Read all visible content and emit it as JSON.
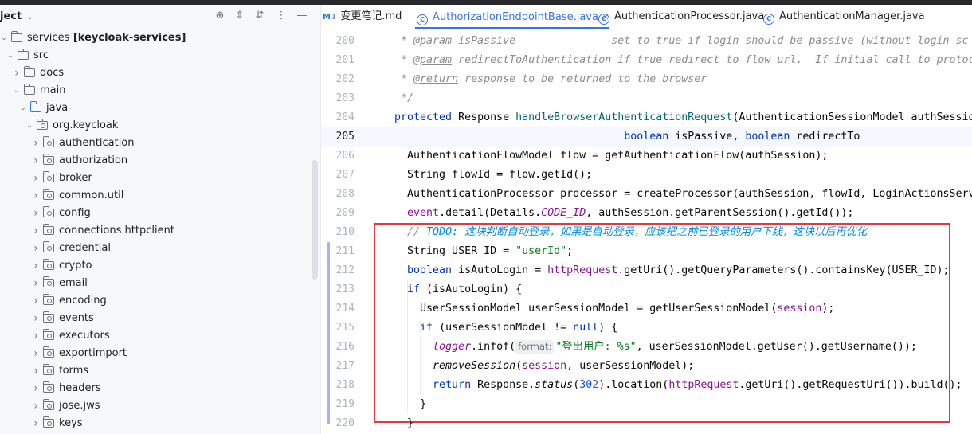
{
  "project": {
    "title": "ject",
    "tree": [
      {
        "label": "services",
        "bold": "[keycloak-services]",
        "depth": 0,
        "arrow": "down",
        "icon": "module"
      },
      {
        "label": "src",
        "depth": 1,
        "arrow": "down",
        "icon": "folder"
      },
      {
        "label": "docs",
        "depth": 2,
        "arrow": "right",
        "icon": "folder"
      },
      {
        "label": "main",
        "depth": 2,
        "arrow": "down",
        "icon": "folder"
      },
      {
        "label": "java",
        "depth": 3,
        "arrow": "down",
        "icon": "source-folder"
      },
      {
        "label": "org.keycloak",
        "depth": 4,
        "arrow": "down",
        "icon": "package"
      },
      {
        "label": "authentication",
        "depth": 5,
        "arrow": "right",
        "icon": "package"
      },
      {
        "label": "authorization",
        "depth": 5,
        "arrow": "right",
        "icon": "package"
      },
      {
        "label": "broker",
        "depth": 5,
        "arrow": "right",
        "icon": "package"
      },
      {
        "label": "common.util",
        "depth": 5,
        "arrow": "right",
        "icon": "package"
      },
      {
        "label": "config",
        "depth": 5,
        "arrow": "right",
        "icon": "package"
      },
      {
        "label": "connections.httpclient",
        "depth": 5,
        "arrow": "right",
        "icon": "package"
      },
      {
        "label": "credential",
        "depth": 5,
        "arrow": "right",
        "icon": "package"
      },
      {
        "label": "crypto",
        "depth": 5,
        "arrow": "right",
        "icon": "package"
      },
      {
        "label": "email",
        "depth": 5,
        "arrow": "right",
        "icon": "package"
      },
      {
        "label": "encoding",
        "depth": 5,
        "arrow": "right",
        "icon": "package"
      },
      {
        "label": "events",
        "depth": 5,
        "arrow": "right",
        "icon": "package"
      },
      {
        "label": "executors",
        "depth": 5,
        "arrow": "right",
        "icon": "package"
      },
      {
        "label": "exportimport",
        "depth": 5,
        "arrow": "right",
        "icon": "package"
      },
      {
        "label": "forms",
        "depth": 5,
        "arrow": "right",
        "icon": "package"
      },
      {
        "label": "headers",
        "depth": 5,
        "arrow": "right",
        "icon": "package"
      },
      {
        "label": "jose.jws",
        "depth": 5,
        "arrow": "right",
        "icon": "package"
      },
      {
        "label": "keys",
        "depth": 5,
        "arrow": "right",
        "icon": "package"
      }
    ]
  },
  "tabs": [
    {
      "label": "变更笔记.md",
      "icon": "markdown-icon",
      "active": false
    },
    {
      "label": "AuthorizationEndpointBase.java",
      "icon": "class-icon",
      "active": true,
      "closable": true
    },
    {
      "label": "AuthenticationProcessor.java",
      "icon": "class-icon",
      "active": false
    },
    {
      "label": "AuthenticationManager.java",
      "icon": "class-icon",
      "active": false
    }
  ],
  "editor": {
    "current_line": 205,
    "lines": [
      {
        "n": 200,
        "tokens": [
          [
            "cm",
            "   * "
          ],
          [
            "tag",
            "@param"
          ],
          [
            "cm",
            " isPassive               set to true if login should be passive (without login sc"
          ]
        ]
      },
      {
        "n": 201,
        "tokens": [
          [
            "cm",
            "   * "
          ],
          [
            "tag",
            "@param"
          ],
          [
            "cm",
            " redirectToAuthentication if true redirect to flow url.  If initial call to protoc"
          ]
        ]
      },
      {
        "n": 202,
        "tokens": [
          [
            "cm",
            "   * "
          ],
          [
            "tag",
            "@return"
          ],
          [
            "cm",
            " response to be returned to the browser"
          ]
        ]
      },
      {
        "n": 203,
        "tokens": [
          [
            "cm",
            "   */"
          ]
        ]
      },
      {
        "n": 204,
        "tokens": [
          [
            "kw",
            "  protected "
          ],
          [
            "",
            "Response "
          ],
          [
            "fn",
            "handleBrowserAuthenticationRequest"
          ],
          [
            "",
            "(AuthenticationSessionModel authSessio"
          ]
        ]
      },
      {
        "n": 205,
        "tokens": [
          [
            "",
            "                                      "
          ],
          [
            "kw",
            "boolean "
          ],
          [
            "",
            "isPassive, "
          ],
          [
            "kw",
            "boolean "
          ],
          [
            "",
            "redirectTo"
          ]
        ]
      },
      {
        "n": 206,
        "tokens": [
          [
            "",
            "    AuthenticationFlowModel flow = getAuthenticationFlow(authSession);"
          ]
        ]
      },
      {
        "n": 207,
        "tokens": [
          [
            "",
            "    String flowId = flow.getId();"
          ]
        ]
      },
      {
        "n": 208,
        "tokens": [
          [
            "",
            "    AuthenticationProcessor processor = createProcessor(authSession, flowId, LoginActionsServ"
          ]
        ]
      },
      {
        "n": 209,
        "tokens": [
          [
            "fld",
            "    event"
          ],
          [
            "",
            ".detail(Details."
          ],
          [
            "fldi",
            "CODE_ID"
          ],
          [
            "",
            ", authSession.getParentSession().getId());"
          ]
        ]
      },
      {
        "n": 210,
        "tokens": [
          [
            "cm",
            "    // "
          ],
          [
            "todo",
            "TODO: 这块判断自动登录，如果是自动登录，应该把之前已登录的用户下线，这块以后再优化"
          ]
        ]
      },
      {
        "n": 211,
        "tokens": [
          [
            "",
            "    String USER_ID = "
          ],
          [
            "st",
            "\"userId\""
          ],
          [
            "",
            ";"
          ]
        ]
      },
      {
        "n": 212,
        "tokens": [
          [
            "kw",
            "    boolean "
          ],
          [
            "",
            "isAutoLogin = "
          ],
          [
            "fld",
            "httpRequest"
          ],
          [
            "",
            ".getUri().getQueryParameters().containsKey(USER_ID);"
          ]
        ]
      },
      {
        "n": 213,
        "tokens": [
          [
            "kw",
            "    if "
          ],
          [
            "",
            "(isAutoLogin) {"
          ]
        ]
      },
      {
        "n": 214,
        "tokens": [
          [
            "",
            "      UserSessionModel userSessionModel = getUserSessionModel("
          ],
          [
            "fld",
            "session"
          ],
          [
            "",
            ");"
          ]
        ]
      },
      {
        "n": 215,
        "tokens": [
          [
            "kw",
            "      if "
          ],
          [
            "",
            "(userSessionModel != "
          ],
          [
            "kw",
            "null"
          ],
          [
            "",
            ") {"
          ]
        ]
      },
      {
        "n": 216,
        "tokens": [
          [
            "fldi",
            "        logger"
          ],
          [
            "",
            ".infof("
          ],
          [
            "hint",
            "format:"
          ],
          [
            "st",
            "\"登出用户: %s\""
          ],
          [
            "",
            ", userSessionModel.getUser().getUsername());"
          ]
        ]
      },
      {
        "n": 217,
        "tokens": [
          [
            "it",
            "        removeSession"
          ],
          [
            "",
            "("
          ],
          [
            "fld",
            "session"
          ],
          [
            "",
            ", userSessionModel);"
          ]
        ]
      },
      {
        "n": 218,
        "tokens": [
          [
            "kw",
            "        return "
          ],
          [
            "",
            "Response."
          ],
          [
            "it",
            "status"
          ],
          [
            "",
            "("
          ],
          [
            "num",
            "302"
          ],
          [
            "",
            ").location("
          ],
          [
            "fld",
            "httpRequest"
          ],
          [
            "",
            ".getUri().getRequestUri()).build();"
          ]
        ]
      },
      {
        "n": 219,
        "tokens": [
          [
            "",
            "      }"
          ]
        ]
      },
      {
        "n": 220,
        "tokens": [
          [
            "",
            "    }"
          ]
        ]
      }
    ]
  },
  "colors": {
    "accent": "#3574f0",
    "highlight_box": "#e0393e"
  }
}
